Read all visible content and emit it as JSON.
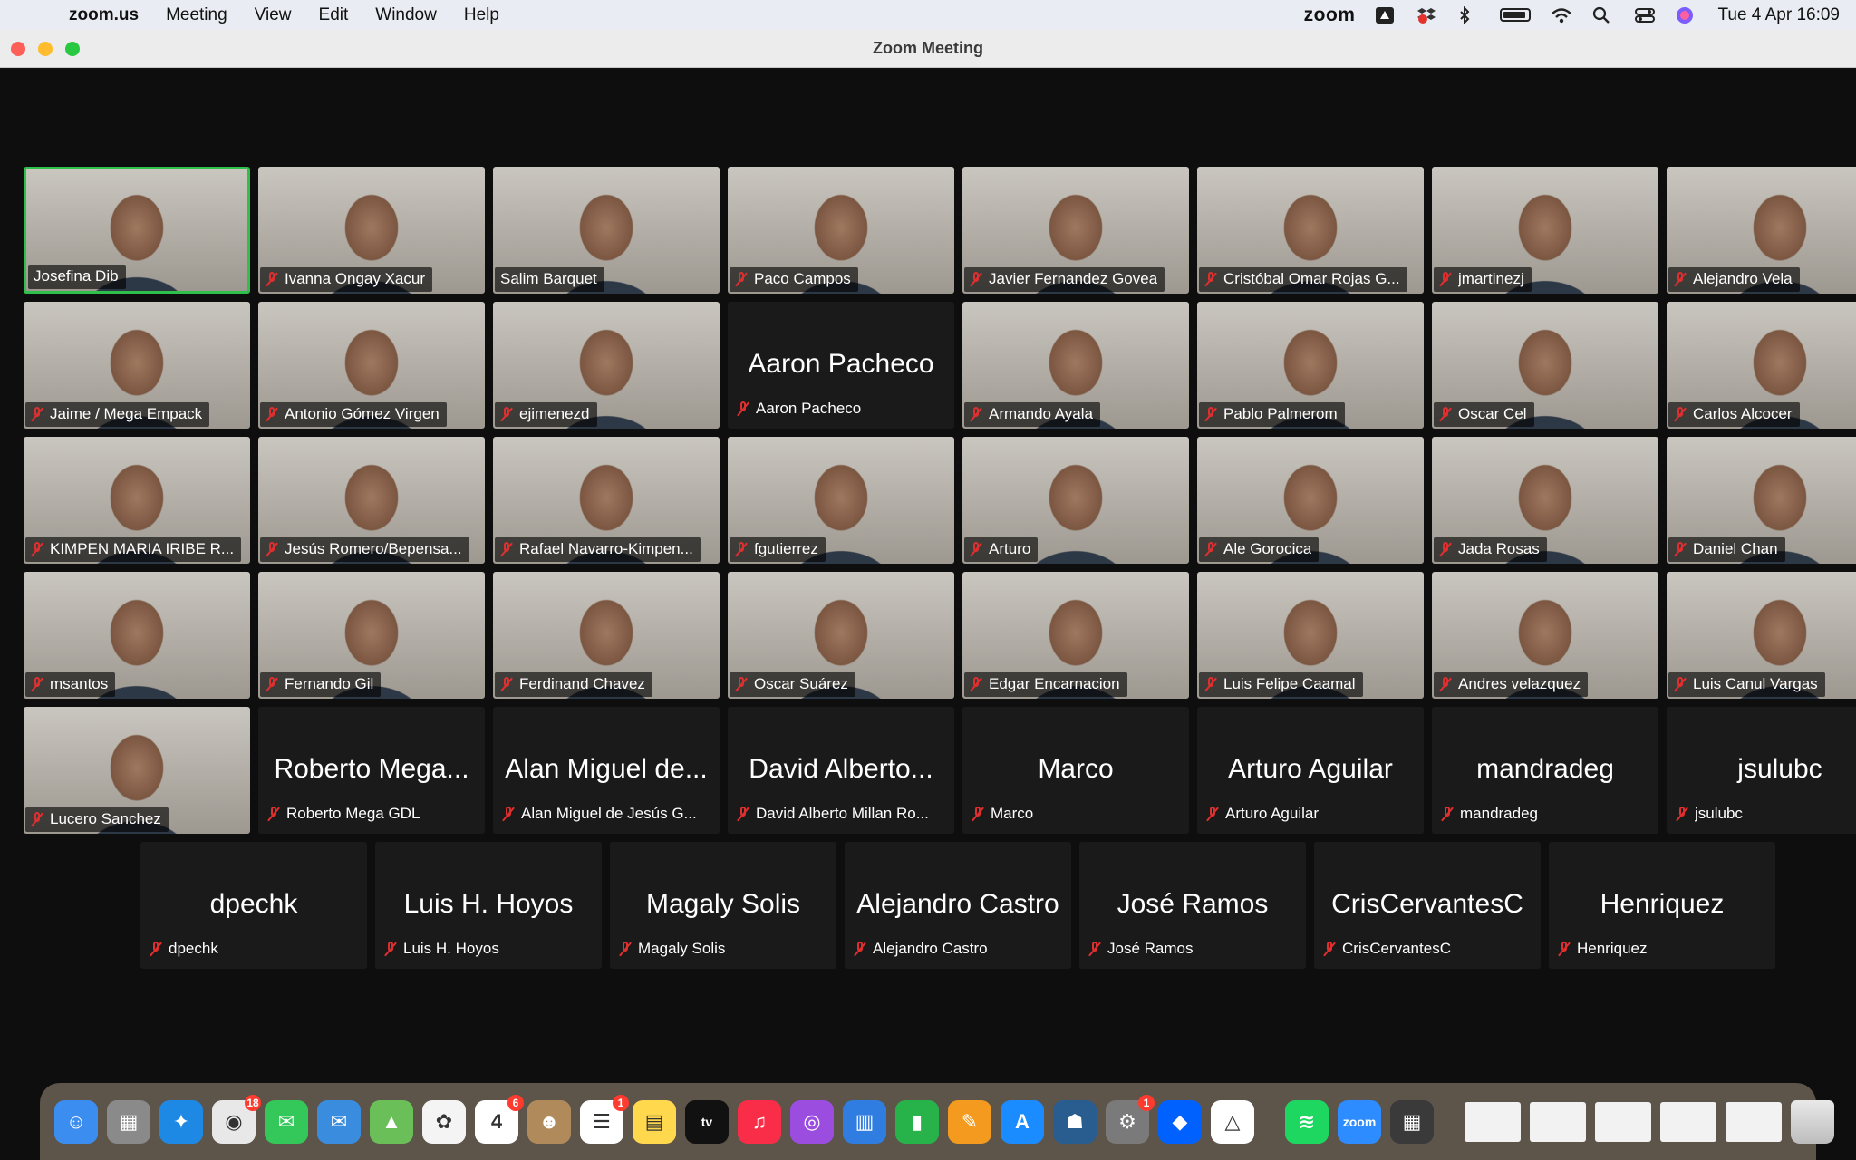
{
  "menubar": {
    "app_name": "zoom.us",
    "items": [
      "Meeting",
      "View",
      "Edit",
      "Window",
      "Help"
    ],
    "status_zoom": "zoom",
    "datetime": "Tue 4 Apr  16:09"
  },
  "window": {
    "title": "Zoom Meeting"
  },
  "participants": [
    {
      "name": "Josefina Dib",
      "video": true,
      "muted": false,
      "active": true
    },
    {
      "name": "Ivanna Ongay Xacur",
      "video": true,
      "muted": true
    },
    {
      "name": "Salim Barquet",
      "video": true,
      "muted": false
    },
    {
      "name": "Paco Campos",
      "video": true,
      "muted": true
    },
    {
      "name": "Javier Fernandez Govea",
      "video": true,
      "muted": true
    },
    {
      "name": "Cristóbal Omar Rojas G...",
      "video": true,
      "muted": true
    },
    {
      "name": "jmartinezj",
      "video": true,
      "muted": true
    },
    {
      "name": "Alejandro Vela",
      "video": true,
      "muted": true
    },
    {
      "name": "Jaime / Mega Empack",
      "video": true,
      "muted": true
    },
    {
      "name": "Antonio Gómez Virgen",
      "video": true,
      "muted": true
    },
    {
      "name": "ejimenezd",
      "video": true,
      "muted": true
    },
    {
      "name": "Aaron Pacheco",
      "video": false,
      "muted": true,
      "display": "Aaron Pacheco"
    },
    {
      "name": "Armando Ayala",
      "video": true,
      "muted": true
    },
    {
      "name": "Pablo Palmerom",
      "video": true,
      "muted": true
    },
    {
      "name": "Oscar Cel",
      "video": true,
      "muted": true
    },
    {
      "name": "Carlos Alcocer",
      "video": true,
      "muted": true
    },
    {
      "name": "KIMPEN MARIA IRIBE R...",
      "video": true,
      "muted": true
    },
    {
      "name": "Jesús Romero/Bepensa...",
      "video": true,
      "muted": true
    },
    {
      "name": "Rafael Navarro-Kimpen...",
      "video": true,
      "muted": true
    },
    {
      "name": "fgutierrez",
      "video": true,
      "muted": true
    },
    {
      "name": "Arturo",
      "video": true,
      "muted": true
    },
    {
      "name": "Ale Gorocica",
      "video": true,
      "muted": true
    },
    {
      "name": "Jada Rosas",
      "video": true,
      "muted": true
    },
    {
      "name": "Daniel Chan",
      "video": true,
      "muted": true
    },
    {
      "name": "msantos",
      "video": true,
      "muted": true
    },
    {
      "name": "Fernando Gil",
      "video": true,
      "muted": true
    },
    {
      "name": "Ferdinand Chavez",
      "video": true,
      "muted": true
    },
    {
      "name": "Oscar Suárez",
      "video": true,
      "muted": true
    },
    {
      "name": "Edgar Encarnacion",
      "video": true,
      "muted": true
    },
    {
      "name": "Luis Felipe Caamal",
      "video": true,
      "muted": true
    },
    {
      "name": "Andres velazquez",
      "video": true,
      "muted": true
    },
    {
      "name": "Luis Canul Vargas",
      "video": true,
      "muted": true
    },
    {
      "name": "Lucero Sanchez",
      "video": true,
      "muted": true
    },
    {
      "name": "Roberto Mega GDL",
      "video": false,
      "muted": true,
      "display": "Roberto Mega..."
    },
    {
      "name": "Alan Miguel de Jesús G...",
      "video": false,
      "muted": true,
      "display": "Alan Miguel de..."
    },
    {
      "name": "David Alberto Millan Ro...",
      "video": false,
      "muted": true,
      "display": "David Alberto..."
    },
    {
      "name": "Marco",
      "video": false,
      "muted": true,
      "display": "Marco"
    },
    {
      "name": "Arturo Aguilar",
      "video": false,
      "muted": true,
      "display": "Arturo Aguilar"
    },
    {
      "name": "mandradeg",
      "video": false,
      "muted": true,
      "display": "mandradeg"
    },
    {
      "name": "jsulubc",
      "video": false,
      "muted": true,
      "display": "jsulubc"
    },
    {
      "name": "dpechk",
      "video": false,
      "muted": true,
      "display": "dpechk"
    },
    {
      "name": "Luis H. Hoyos",
      "video": false,
      "muted": true,
      "display": "Luis H. Hoyos"
    },
    {
      "name": "Magaly Solis",
      "video": false,
      "muted": true,
      "display": "Magaly Solis"
    },
    {
      "name": "Alejandro Castro",
      "video": false,
      "muted": true,
      "display": "Alejandro Castro"
    },
    {
      "name": "José Ramos",
      "video": false,
      "muted": true,
      "display": "José Ramos"
    },
    {
      "name": "CrisCervantesC",
      "video": false,
      "muted": true,
      "display": "CrisCervantesC"
    },
    {
      "name": "Henriquez",
      "video": false,
      "muted": true,
      "display": "Henriquez"
    }
  ],
  "dock": {
    "apps": [
      {
        "icon": "finder-icon",
        "color": "#3b8ef0",
        "glyph": "☺"
      },
      {
        "icon": "launchpad-icon",
        "color": "#8a8a8a",
        "glyph": "▦"
      },
      {
        "icon": "safari-icon",
        "color": "#1e88e5",
        "glyph": "✦"
      },
      {
        "icon": "chrome-icon",
        "color": "#e8e8e8",
        "glyph": "◉",
        "badge": "18"
      },
      {
        "icon": "messages-icon",
        "color": "#34c759",
        "glyph": "✉"
      },
      {
        "icon": "mail-icon",
        "color": "#3a8dde",
        "glyph": "✉"
      },
      {
        "icon": "maps-icon",
        "color": "#6bbf59",
        "glyph": "▲"
      },
      {
        "icon": "photos-icon",
        "color": "#f4f4f4",
        "glyph": "✿"
      },
      {
        "icon": "calendar-icon",
        "color": "#ffffff",
        "glyph": "4",
        "badge": "6"
      },
      {
        "icon": "contacts-icon",
        "color": "#b08a5a",
        "glyph": "☻"
      },
      {
        "icon": "reminders-icon",
        "color": "#ffffff",
        "glyph": "☰",
        "badge": "1"
      },
      {
        "icon": "notes-icon",
        "color": "#ffd84d",
        "glyph": "▤"
      },
      {
        "icon": "apple-tv-icon",
        "color": "#111111",
        "glyph": "tv"
      },
      {
        "icon": "music-icon",
        "color": "#fa2d48",
        "glyph": "♫"
      },
      {
        "icon": "podcasts-icon",
        "color": "#9b4de0",
        "glyph": "◎"
      },
      {
        "icon": "keynote-icon",
        "color": "#2f7de1",
        "glyph": "▥"
      },
      {
        "icon": "numbers-icon",
        "color": "#27b24a",
        "glyph": "▮"
      },
      {
        "icon": "pages-icon",
        "color": "#f39a1f",
        "glyph": "✎"
      },
      {
        "icon": "app-store-icon",
        "color": "#1a8cff",
        "glyph": "A"
      },
      {
        "icon": "kindle-icon",
        "color": "#2a5d8f",
        "glyph": "☗"
      },
      {
        "icon": "system-settings-icon",
        "color": "#7a7a7a",
        "glyph": "⚙",
        "badge": "1"
      },
      {
        "icon": "dropbox-icon",
        "color": "#0061fe",
        "glyph": "◆"
      },
      {
        "icon": "google-drive-icon",
        "color": "#ffffff",
        "glyph": "△"
      },
      {
        "icon": "spotify-icon",
        "color": "#1ed760",
        "glyph": "≋"
      },
      {
        "icon": "zoom-icon",
        "color": "#2d8cff",
        "glyph": "zoom"
      },
      {
        "icon": "calculator-icon",
        "color": "#3a3a3a",
        "glyph": "▦"
      }
    ],
    "recent_docs": [
      "doc-thumbnail-icon",
      "doc-thumbnail-icon",
      "doc-thumbnail-icon",
      "doc-thumbnail-icon",
      "doc-thumbnail-icon"
    ],
    "trash": "trash-icon"
  },
  "colors": {
    "active_speaker": "#2fbf4b",
    "muted": "#e02f2f",
    "tile_bg": "#1a1a1a"
  }
}
